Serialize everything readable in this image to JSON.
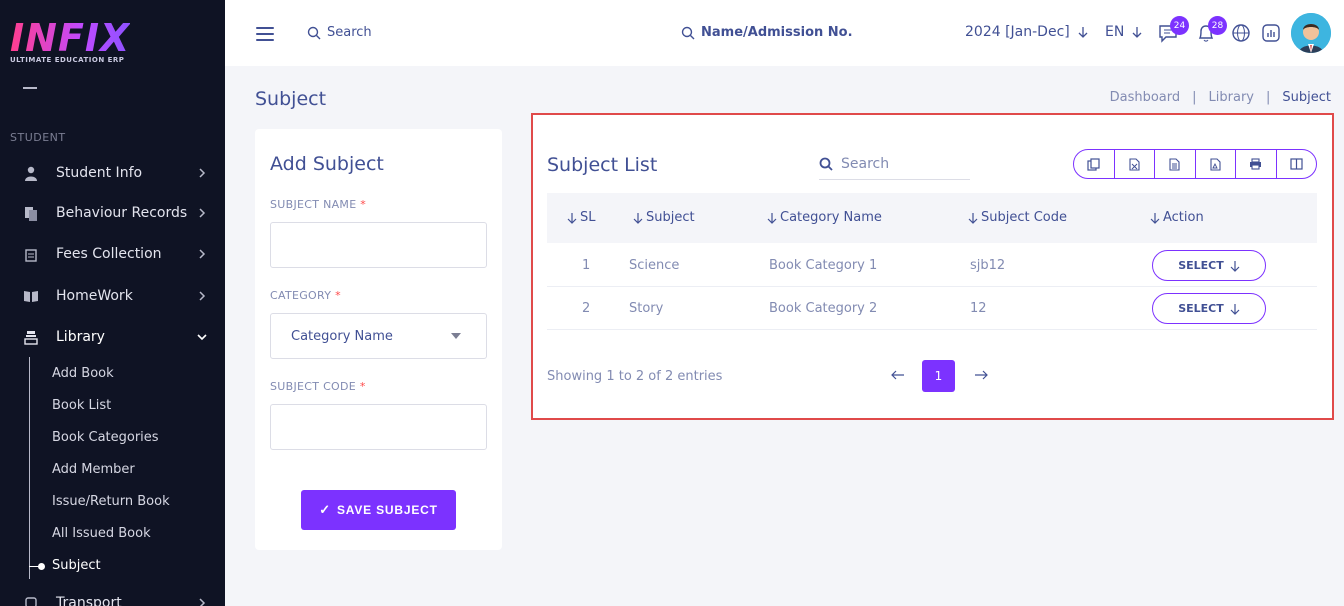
{
  "brand": {
    "logo_text": "INFIX",
    "tagline": "ULTIMATE EDUCATION ERP"
  },
  "sidebar": {
    "section": "STUDENT",
    "items": [
      {
        "label": "Student Info",
        "icon": "student-icon"
      },
      {
        "label": "Behaviour Records",
        "icon": "records-icon"
      },
      {
        "label": "Fees Collection",
        "icon": "fees-icon"
      },
      {
        "label": "HomeWork",
        "icon": "book-open-icon"
      },
      {
        "label": "Library",
        "icon": "library-icon"
      },
      {
        "label": "Transport",
        "icon": "bus-icon"
      }
    ],
    "library_sub": [
      "Add Book",
      "Book List",
      "Book Categories",
      "Add Member",
      "Issue/Return Book",
      "All Issued Book",
      "Subject"
    ]
  },
  "header": {
    "search_label": "Search",
    "student_search_label": "Name/Admission No.",
    "year": "2024 [Jan-Dec]",
    "lang": "EN",
    "messages_count": "24",
    "notifications_count": "28"
  },
  "page": {
    "title": "Subject",
    "breadcrumb": [
      "Dashboard",
      "Library",
      "Subject"
    ],
    "separator": "|"
  },
  "add_subject": {
    "title": "Add Subject",
    "subject_name_label": "SUBJECT NAME",
    "category_label": "CATEGORY",
    "category_value": "Category Name",
    "subject_code_label": "SUBJECT CODE",
    "required_mark": "*",
    "save_label": "SAVE SUBJECT",
    "save_check": "✓"
  },
  "subject_list": {
    "title": "Subject List",
    "search_placeholder": "Search",
    "columns": [
      "SL",
      "Subject",
      "Category Name",
      "Subject Code",
      "Action"
    ],
    "rows": [
      {
        "sl": "1",
        "subject": "Science",
        "category": "Book Category 1",
        "code": "sjb12",
        "action": "SELECT"
      },
      {
        "sl": "2",
        "subject": "Story",
        "category": "Book Category 2",
        "code": "12",
        "action": "SELECT"
      }
    ],
    "showing": "Showing 1 to 2 of 2 entries",
    "current_page": "1"
  },
  "colors": {
    "accent": "#7c32ff",
    "sidebar_bg": "#0f1324",
    "text": "#415094",
    "highlight_border": "#e04a4a"
  }
}
